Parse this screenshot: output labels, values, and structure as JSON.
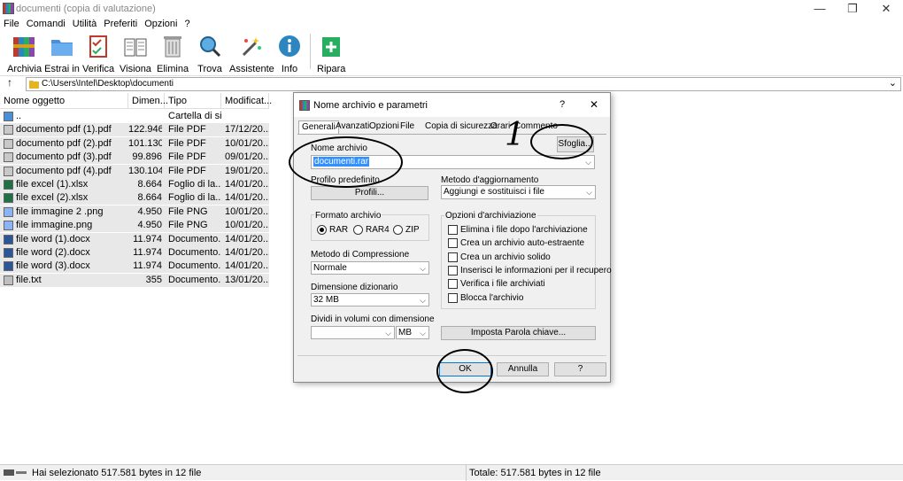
{
  "window": {
    "title": "documenti (copia di valutazione)",
    "min": "—",
    "max": "❐",
    "close": "✕"
  },
  "menu": [
    "File",
    "Comandi",
    "Utilità",
    "Preferiti",
    "Opzioni",
    "?"
  ],
  "toolbar": {
    "archivia": "Archivia",
    "estrai": "Estrai in",
    "verifica": "Verifica",
    "visiona": "Visiona",
    "elimina": "Elimina",
    "trova": "Trova",
    "assistente": "Assistente",
    "info": "Info",
    "ripara": "Ripara"
  },
  "address": {
    "up": "↑",
    "path": "C:\\Users\\Intel\\Desktop\\documenti",
    "dropdown": "⌄"
  },
  "columns": {
    "name": "Nome oggetto",
    "size": "Dimen...",
    "type": "Tipo",
    "modified": "Modificat..."
  },
  "files": [
    {
      "name": "..",
      "size": "",
      "type": "Cartella di si...",
      "date": "",
      "icon": "folder"
    },
    {
      "name": "documento pdf (1).pdf",
      "size": "122.946",
      "type": "File PDF",
      "date": "17/12/20...",
      "icon": "pdf"
    },
    {
      "name": "documento pdf (2).pdf",
      "size": "101.130",
      "type": "File PDF",
      "date": "10/01/20...",
      "icon": "pdf"
    },
    {
      "name": "documento pdf (3).pdf",
      "size": "99.896",
      "type": "File PDF",
      "date": "09/01/20...",
      "icon": "pdf"
    },
    {
      "name": "documento pdf (4).pdf",
      "size": "130.104",
      "type": "File PDF",
      "date": "19/01/20...",
      "icon": "pdf"
    },
    {
      "name": "file excel (1).xlsx",
      "size": "8.664",
      "type": "Foglio di la...",
      "date": "14/01/20...",
      "icon": "excel"
    },
    {
      "name": "file excel (2).xlsx",
      "size": "8.664",
      "type": "Foglio di la...",
      "date": "14/01/20...",
      "icon": "excel"
    },
    {
      "name": "file immagine 2 .png",
      "size": "4.950",
      "type": "File PNG",
      "date": "10/01/20...",
      "icon": "image"
    },
    {
      "name": "file immagine.png",
      "size": "4.950",
      "type": "File PNG",
      "date": "10/01/20...",
      "icon": "image"
    },
    {
      "name": "file word (1).docx",
      "size": "11.974",
      "type": "Documento...",
      "date": "14/01/20...",
      "icon": "word"
    },
    {
      "name": "file word (2).docx",
      "size": "11.974",
      "type": "Documento...",
      "date": "14/01/20...",
      "icon": "word"
    },
    {
      "name": "file word (3).docx",
      "size": "11.974",
      "type": "Documento...",
      "date": "14/01/20...",
      "icon": "word"
    },
    {
      "name": "file.txt",
      "size": "355",
      "type": "Documento...",
      "date": "13/01/20...",
      "icon": "text"
    }
  ],
  "status": {
    "left": "Hai selezionato 517.581 bytes in 12 file",
    "right": "Totale: 517.581 bytes in 12 file"
  },
  "dialog": {
    "title": "Nome archivio e parametri",
    "help": "?",
    "close": "✕",
    "tabs": [
      "Generali",
      "Avanzati",
      "Opzioni",
      "File",
      "Copia di sicurezza",
      "Orari",
      "Commento"
    ],
    "name_label": "Nome archivio",
    "name_value": "documenti.rar",
    "browse": "Sfoglia...",
    "profile_label": "Profilo predefinito",
    "profile_button": "Profili...",
    "update_label": "Metodo d'aggiornamento",
    "update_value": "Aggiungi e sostituisci i file",
    "format_label": "Formato archivio",
    "formats": [
      "RAR",
      "RAR4",
      "ZIP"
    ],
    "selected_format": "RAR",
    "options_label": "Opzioni d'archiviazione",
    "options": [
      "Elimina i file dopo l'archiviazione",
      "Crea un archivio auto-estraente",
      "Crea un archivio solido",
      "Inserisci le informazioni per il recupero",
      "Verifica i file archiviati",
      "Blocca l'archivio"
    ],
    "compression_label": "Metodo di Compressione",
    "compression_value": "Normale",
    "dict_label": "Dimensione dizionario",
    "dict_value": "32 MB",
    "split_label": "Dividi in volumi con dimensione",
    "split_value": "",
    "split_unit": "MB",
    "password_button": "Imposta Parola chiave...",
    "ok": "OK",
    "cancel": "Annulla",
    "help_button": "?"
  },
  "annotation": {
    "number": "1"
  }
}
